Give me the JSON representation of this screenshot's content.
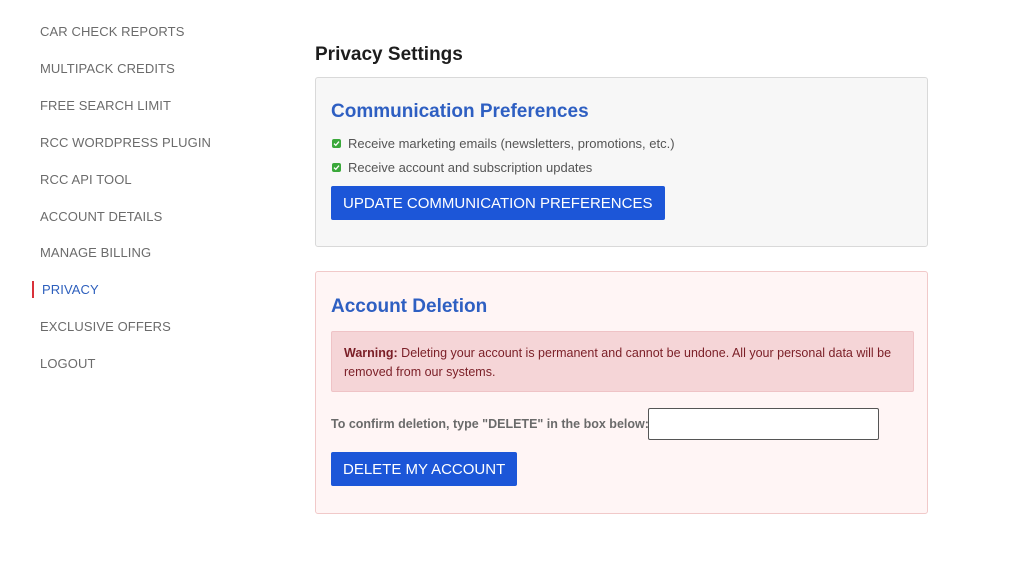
{
  "sidebar": {
    "items": [
      {
        "label": "CAR CHECK REPORTS"
      },
      {
        "label": "MULTIPACK CREDITS"
      },
      {
        "label": "FREE SEARCH LIMIT"
      },
      {
        "label": "RCC WORDPRESS PLUGIN"
      },
      {
        "label": "RCC API TOOL"
      },
      {
        "label": "ACCOUNT DETAILS"
      },
      {
        "label": "MANAGE BILLING"
      },
      {
        "label": "PRIVACY",
        "active": true
      },
      {
        "label": "EXCLUSIVE OFFERS"
      },
      {
        "label": "LOGOUT"
      }
    ]
  },
  "main": {
    "title": "Privacy Settings",
    "communication": {
      "heading": "Communication Preferences",
      "options": [
        {
          "label": "Receive marketing emails (newsletters, promotions, etc.)",
          "checked": true
        },
        {
          "label": "Receive account and subscription updates",
          "checked": true
        }
      ],
      "button_label": "UPDATE COMMUNICATION PREFERENCES"
    },
    "deletion": {
      "heading": "Account Deletion",
      "warning_prefix": "Warning:",
      "warning_text": " Deleting your account is permanent and cannot be undone. All your personal data will be removed from our systems.",
      "confirm_label": "To confirm deletion, type \"DELETE\" in the box below:",
      "confirm_value": "",
      "button_label": "DELETE MY ACCOUNT"
    }
  },
  "colors": {
    "accent": "#2e5fc2",
    "button": "#1c56d8",
    "active_marker": "#d9313a",
    "warning_bg": "#f5d5d7",
    "checkbox": "#3aa83a"
  }
}
